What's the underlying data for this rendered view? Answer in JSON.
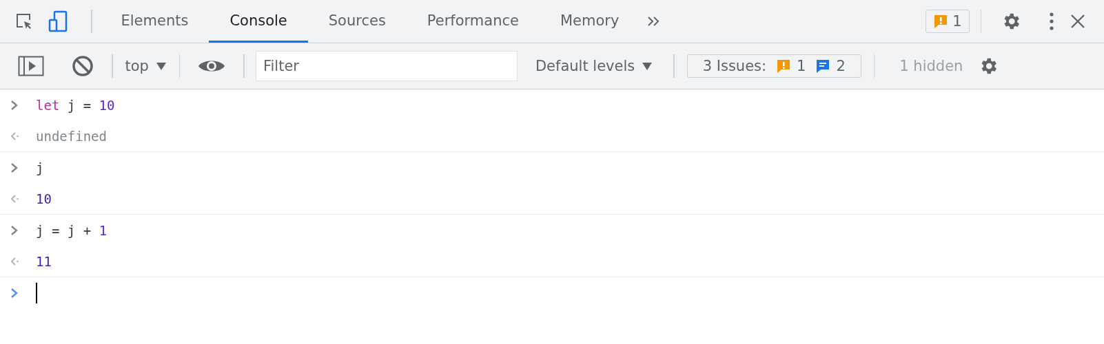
{
  "tabs": [
    {
      "label": "Elements",
      "selected": false
    },
    {
      "label": "Console",
      "selected": true
    },
    {
      "label": "Sources",
      "selected": false
    },
    {
      "label": "Performance",
      "selected": false
    },
    {
      "label": "Memory",
      "selected": false
    }
  ],
  "issues_badge": {
    "count": "1"
  },
  "console_toolbar": {
    "context": "top",
    "filter": {
      "placeholder": "Filter"
    },
    "levels": "Default levels",
    "issues": {
      "label": "3 Issues:",
      "warnings": "1",
      "messages": "2"
    },
    "hidden": "1 hidden"
  },
  "commands": [
    {
      "input": [
        {
          "kind": "keyword",
          "text": "let"
        },
        {
          "kind": "variable",
          "text": "j"
        },
        {
          "kind": "operator",
          "text": "="
        },
        {
          "kind": "number",
          "text": "10"
        }
      ],
      "result": {
        "kind": "undefined",
        "text": "undefined"
      }
    },
    {
      "input": [
        {
          "kind": "variable",
          "text": "j"
        }
      ],
      "result": {
        "kind": "number",
        "text": "10"
      }
    },
    {
      "input": [
        {
          "kind": "variable",
          "text": "j"
        },
        {
          "kind": "operator",
          "text": "="
        },
        {
          "kind": "variable",
          "text": "j"
        },
        {
          "kind": "operator",
          "text": "+"
        },
        {
          "kind": "number",
          "text": "1"
        }
      ],
      "result": {
        "kind": "number",
        "text": "11"
      }
    }
  ]
}
